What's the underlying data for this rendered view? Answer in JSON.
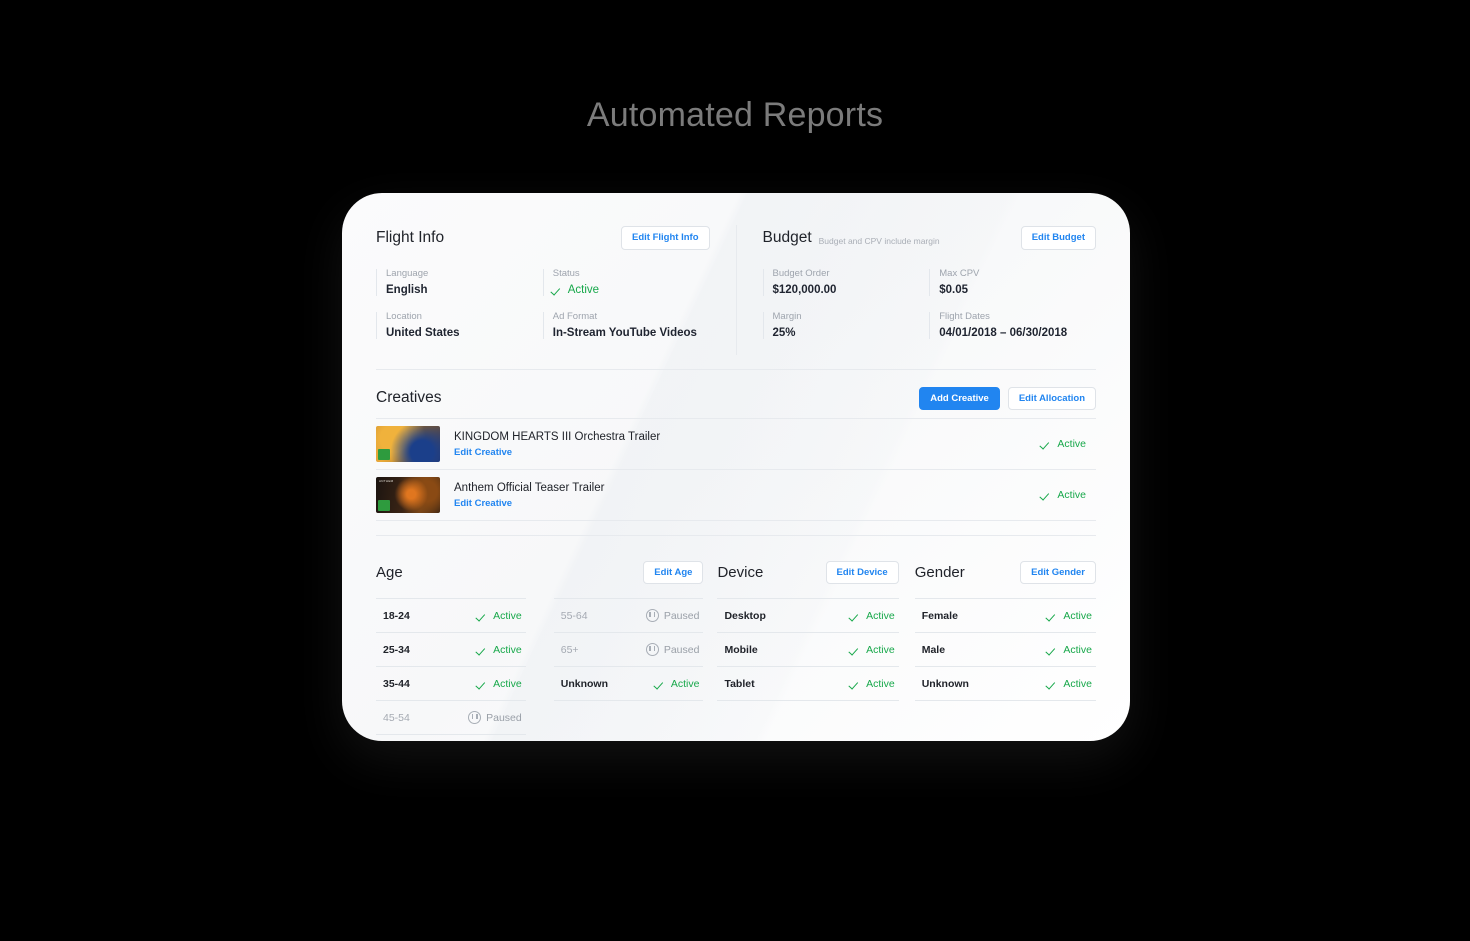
{
  "page": {
    "title": "Automated Reports"
  },
  "colors": {
    "accent_blue": "#2185f0",
    "active_green": "#17a84a",
    "paused_gray": "#9aa0a8",
    "title_gray": "#7b7b7b"
  },
  "flight_info": {
    "title": "Flight Info",
    "edit_label": "Edit Flight Info",
    "fields": [
      {
        "label": "Language",
        "value": "English",
        "type": "text"
      },
      {
        "label": "Status",
        "value": "Active",
        "type": "status"
      },
      {
        "label": "Location",
        "value": "United States",
        "type": "text"
      },
      {
        "label": "Ad Format",
        "value": "In-Stream YouTube Videos",
        "type": "text"
      }
    ]
  },
  "budget": {
    "title": "Budget",
    "subtitle": "Budget and CPV include margin",
    "edit_label": "Edit Budget",
    "fields": [
      {
        "label": "Budget Order",
        "value": "$120,000.00"
      },
      {
        "label": "Max CPV",
        "value": "$0.05"
      },
      {
        "label": "Margin",
        "value": "25%"
      },
      {
        "label": "Flight Dates",
        "value": "04/01/2018 – 06/30/2018"
      }
    ]
  },
  "creatives": {
    "title": "Creatives",
    "add_label": "Add Creative",
    "edit_allocation_label": "Edit Allocation",
    "edit_creative_label": "Edit Creative",
    "items": [
      {
        "name": "KINGDOM HEARTS III Orchestra Trailer",
        "edit_label": "Edit Creative",
        "status": "Active",
        "thumb_caption": ""
      },
      {
        "name": "Anthem Official Teaser Trailer",
        "edit_label": "Edit Creative",
        "status": "Active",
        "thumb_caption": "ANTHEM"
      }
    ]
  },
  "age": {
    "title": "Age",
    "edit_label": "Edit Age",
    "col1": [
      {
        "label": "18-24",
        "status": "Active"
      },
      {
        "label": "25-34",
        "status": "Active"
      },
      {
        "label": "35-44",
        "status": "Active"
      },
      {
        "label": "45-54",
        "status": "Paused"
      }
    ],
    "col2": [
      {
        "label": "55-64",
        "status": "Paused"
      },
      {
        "label": "65+",
        "status": "Paused"
      },
      {
        "label": "Unknown",
        "status": "Active"
      }
    ]
  },
  "device": {
    "title": "Device",
    "edit_label": "Edit Device",
    "rows": [
      {
        "label": "Desktop",
        "status": "Active"
      },
      {
        "label": "Mobile",
        "status": "Active"
      },
      {
        "label": "Tablet",
        "status": "Active"
      }
    ]
  },
  "gender": {
    "title": "Gender",
    "edit_label": "Edit Gender",
    "rows": [
      {
        "label": "Female",
        "status": "Active"
      },
      {
        "label": "Male",
        "status": "Active"
      },
      {
        "label": "Unknown",
        "status": "Active"
      }
    ]
  }
}
